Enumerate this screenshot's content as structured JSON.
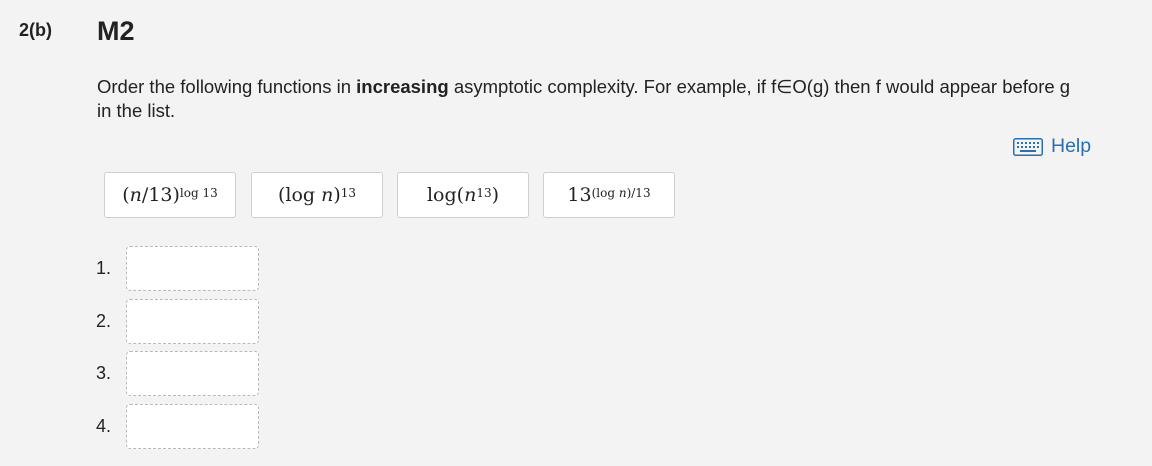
{
  "question": {
    "number": "2(b)",
    "title": "M2",
    "prompt_pre": "Order the following functions in ",
    "prompt_bold": "increasing",
    "prompt_post": " asymptotic complexity.  For example, if f∈O(g) then f would appear before g in the list."
  },
  "help": {
    "label": "Help",
    "icon": "keyboard-icon"
  },
  "tiles": [
    {
      "base": "(n/13)",
      "exponent": "log 13"
    },
    {
      "base": "(log n)",
      "exponent": "13"
    },
    {
      "base": "log(n",
      "exponent": "13",
      "close": ")"
    },
    {
      "base": "13",
      "exponent": "(log n)/13"
    }
  ],
  "answer_slots": [
    {
      "label": "1.",
      "value": ""
    },
    {
      "label": "2.",
      "value": ""
    },
    {
      "label": "3.",
      "value": ""
    },
    {
      "label": "4.",
      "value": ""
    }
  ]
}
